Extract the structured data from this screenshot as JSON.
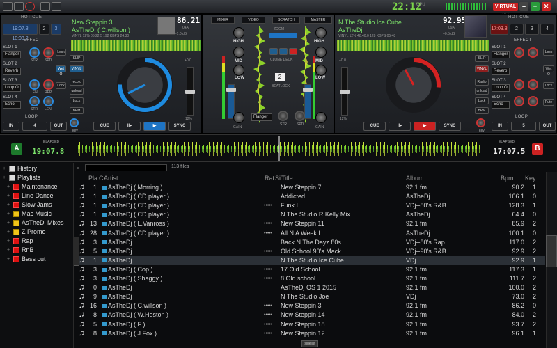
{
  "topbar": {
    "clock": "22:12",
    "cpu_label": "CPU",
    "brand": "VIRTUAL DJ"
  },
  "deck_left": {
    "hotcue_label": "HOT CUE",
    "hotcue_buttons": [
      "19:07.8 10:03.2",
      "2",
      "3",
      "4"
    ],
    "effect_label": "EFFECT",
    "slots": [
      {
        "label": "SLOT 1",
        "effect": "Flanger"
      },
      {
        "label": "SLOT 2",
        "effect": "Reverb"
      },
      {
        "label": "SLOT 3",
        "effect": "Loop Ou"
      },
      {
        "label": "SLOT 4",
        "effect": "Echo"
      }
    ],
    "knob_labels": [
      "STR",
      "SPD",
      "LEN",
      "REP",
      "STR",
      "LEN"
    ],
    "side_buttons": [
      "Lock",
      "Wet O",
      "Lock"
    ],
    "loop_label": "LOOP",
    "loop_in": "IN",
    "loop_out": "OUT",
    "loop_value": "4",
    "title": "New Steppin 3",
    "artist": "AsTheDj ( C.willson )",
    "bpm": "86.21",
    "key": "04A",
    "gain": "-1.0 dB",
    "info_line": "VINYL    12%   05:22.5   192 KBPS   24:30",
    "sidebuttons": [
      "SLIP",
      "VINYL",
      "record",
      "unload",
      "Lock",
      "BPM"
    ],
    "pitch_value": "+0.0",
    "pitch_pct": "12%",
    "transport": [
      "CUE",
      "II▸",
      "▶",
      "SYNC"
    ],
    "elapsed_label": "ELAPSED",
    "elapsed": "19:07.8",
    "badge": "A",
    "keylock_label": "key"
  },
  "deck_right": {
    "hotcue_label": "HOT CUE",
    "hotcue_buttons": [
      "17:03.8",
      "2",
      "3",
      "4"
    ],
    "effect_label": "EFFECT",
    "slots": [
      {
        "label": "SLOT 1",
        "effect": "Flanger"
      },
      {
        "label": "SLOT 2",
        "effect": "Reverb"
      },
      {
        "label": "SLOT 3",
        "effect": "Loop Ou"
      },
      {
        "label": "SLOT 4",
        "effect": "Echo"
      }
    ],
    "side_buttons": [
      "Lock",
      "Wet O",
      "Lock",
      "Pute"
    ],
    "loop_label": "LOOP",
    "loop_in": "IN",
    "loop_out": "OUT",
    "loop_value": "5",
    "title": "N The Studio Ice Cube",
    "artist": "AsTheDj",
    "bpm": "92.95",
    "key": "09A",
    "gain": "+0.5 dB",
    "info_line": "VINYL    12%   48:40.0   128 KBPS   05:48",
    "sidebuttons": [
      "SLIP",
      "VINYL",
      "Radio",
      "unload",
      "Lock",
      "BPM"
    ],
    "pitch_value": "+0.0",
    "pitch_pct": "12%",
    "transport": [
      "CUE",
      "II▸",
      "▶",
      "SYNC"
    ],
    "elapsed_label": "ELAPSED",
    "elapsed": "17:07.5",
    "badge": "B",
    "keylock_label": "key"
  },
  "mixer": {
    "tabs": [
      "MIXER",
      "VIDEO",
      "SCRATCH",
      "MASTER"
    ],
    "eq_labels": [
      "HIGH",
      "MID",
      "LOW",
      "HIGH",
      "MID",
      "LOW"
    ],
    "gain_label": "GAIN",
    "zoom_label": "ZOOM",
    "clone_label": "CLONE DECK",
    "beatlock_label": "BEATLOCK",
    "effect_select": "Flanger",
    "knob_labels": [
      "STR",
      "SPD"
    ],
    "value_display": "2",
    "pitch_left": "+0.0",
    "pitch_right": "+0.0"
  },
  "browser": {
    "folders": [
      {
        "label": "History",
        "icon": "grey",
        "indent": 0
      },
      {
        "label": "Playlists",
        "icon": "grey",
        "indent": 0
      },
      {
        "label": "Maintenance",
        "icon": "red",
        "indent": 1
      },
      {
        "label": "Line Dance",
        "icon": "red",
        "indent": 1
      },
      {
        "label": "Slow Jams",
        "icon": "red",
        "indent": 1
      },
      {
        "label": "Mac Music",
        "icon": "star",
        "indent": 1
      },
      {
        "label": "AsTheDj  Mixes",
        "icon": "star",
        "indent": 1
      },
      {
        "label": "Z Promo",
        "icon": "star",
        "indent": 1
      },
      {
        "label": "Rap",
        "icon": "red",
        "indent": 1
      },
      {
        "label": "RnB",
        "icon": "red",
        "indent": 1
      },
      {
        "label": "Bass cut",
        "icon": "red",
        "indent": 1
      }
    ],
    "search_placeholder": "",
    "file_count": "113 files",
    "columns": [
      "Pla",
      "C",
      "Artist",
      "Rat",
      "Si",
      "Title",
      "Album",
      "Bpm",
      "Key"
    ],
    "rows": [
      {
        "play": "1",
        "artist": "AsTheDj  ( Morring )",
        "rating": "",
        "title": "New Steppin 7",
        "album": "92.1 fm",
        "bpm": "90.2",
        "key": "1"
      },
      {
        "play": "1",
        "artist": "AsTheDj  ( CD player )",
        "rating": "",
        "title": "Addicted",
        "album": "AsTheDj",
        "bpm": "106.1",
        "key": "0"
      },
      {
        "play": "1",
        "artist": "AsTheDj  ( CD player )",
        "rating": "•••••",
        "title": "Funk I",
        "album": "VDj--80's R&B",
        "bpm": "128.3",
        "key": "1"
      },
      {
        "play": "1",
        "artist": "AsTheDj  ( CD player )",
        "rating": "",
        "title": "N The Studio R.Kelly Mix",
        "album": "AsTheDj",
        "bpm": "64.4",
        "key": "0"
      },
      {
        "play": "13",
        "artist": "AsTheDj  ( L.Vanross )",
        "rating": "•••••",
        "title": "New Steppin 11",
        "album": "92.1 fm",
        "bpm": "85.9",
        "key": "2"
      },
      {
        "play": "28",
        "artist": "AsTheDj  ( CD player )",
        "rating": "•••••",
        "title": "All N A Week I",
        "album": "AsTheDj",
        "bpm": "100.1",
        "key": "0"
      },
      {
        "play": "3",
        "artist": "AsTheDj",
        "rating": "",
        "title": "Back N The Dayz 80s",
        "album": "VDj--80's Rap",
        "bpm": "117.0",
        "key": "2"
      },
      {
        "play": "5",
        "artist": "AsTheDj",
        "rating": "•••••",
        "title": "Old School  90's Mack",
        "album": "VDj--90's R&B",
        "bpm": "92.9",
        "key": "2"
      },
      {
        "play": "1",
        "artist": "AsTheDj",
        "rating": "",
        "title": "N The Studio Ice Cube",
        "album": "VDj",
        "bpm": "92.9",
        "key": "1",
        "selected": true
      },
      {
        "play": "3",
        "artist": "AsTheDj  ( Cop )",
        "rating": "•••••",
        "title": "17 Old School",
        "album": "92.1 fm",
        "bpm": "117.3",
        "key": "1"
      },
      {
        "play": "3",
        "artist": "AsTheDj  ( Shaggy )",
        "rating": "•••••",
        "title": " 8 Old school",
        "album": "92.1 fm",
        "bpm": "111.7",
        "key": "2"
      },
      {
        "play": "0",
        "artist": "AsTheDj",
        "rating": "",
        "title": "AsTheDj OS 1 2015",
        "album": "92.1 fm",
        "bpm": "100.0",
        "key": "2"
      },
      {
        "play": "9",
        "artist": "AsTheDj",
        "rating": "",
        "title": "N The Studio Joe",
        "album": "VDj",
        "bpm": "73.0",
        "key": "2"
      },
      {
        "play": "16",
        "artist": "AsTheDj  ( C.willson )",
        "rating": "•••••",
        "title": "New Steppin 3",
        "album": "92.1 fm",
        "bpm": "86.2",
        "key": "0"
      },
      {
        "play": "8",
        "artist": "AsTheDj  ( W.Hoston )",
        "rating": "•••••",
        "title": "New Steppin 14",
        "album": "92.1 fm",
        "bpm": "84.0",
        "key": "2"
      },
      {
        "play": "5",
        "artist": "AsTheDj  ( F )",
        "rating": "•••••",
        "title": "New Steppin 18",
        "album": "92.1 fm",
        "bpm": "93.7",
        "key": "2"
      },
      {
        "play": "8",
        "artist": "AsTheDj  ( J.Fox )",
        "rating": "•••••",
        "title": "New Steppin 12",
        "album": "92.1 fm",
        "bpm": "96.1",
        "key": "1"
      }
    ],
    "sidelist_label": "sidelist"
  },
  "colors": {
    "deck_a_accent": "#1e74c4",
    "deck_b_accent": "#cc2222",
    "wave_green": "#8ed12a",
    "title_green": "#7be06a"
  }
}
